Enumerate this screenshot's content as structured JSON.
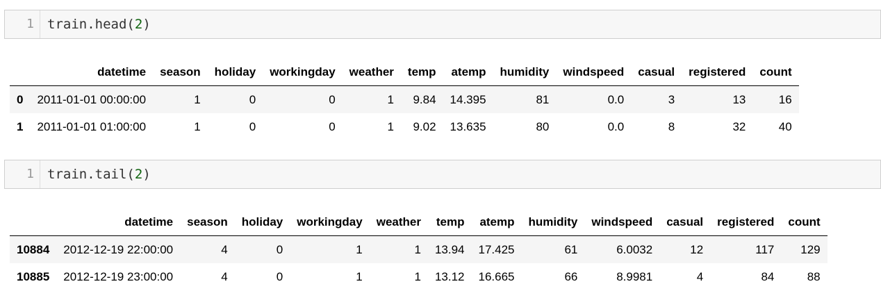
{
  "cells": [
    {
      "line_number": "1",
      "code": {
        "object": "train",
        "dot": ".",
        "method": "head",
        "open": "(",
        "arg": "2",
        "close": ")"
      },
      "table": {
        "columns": [
          "datetime",
          "season",
          "holiday",
          "workingday",
          "weather",
          "temp",
          "atemp",
          "humidity",
          "windspeed",
          "casual",
          "registered",
          "count"
        ],
        "rows": [
          {
            "index": "0",
            "values": [
              "2011-01-01 00:00:00",
              "1",
              "0",
              "0",
              "1",
              "9.84",
              "14.395",
              "81",
              "0.0",
              "3",
              "13",
              "16"
            ]
          },
          {
            "index": "1",
            "values": [
              "2011-01-01 01:00:00",
              "1",
              "0",
              "0",
              "1",
              "9.02",
              "13.635",
              "80",
              "0.0",
              "8",
              "32",
              "40"
            ]
          }
        ]
      }
    },
    {
      "line_number": "1",
      "code": {
        "object": "train",
        "dot": ".",
        "method": "tail",
        "open": "(",
        "arg": "2",
        "close": ")"
      },
      "table": {
        "columns": [
          "datetime",
          "season",
          "holiday",
          "workingday",
          "weather",
          "temp",
          "atemp",
          "humidity",
          "windspeed",
          "casual",
          "registered",
          "count"
        ],
        "rows": [
          {
            "index": "10884",
            "values": [
              "2012-12-19 22:00:00",
              "4",
              "0",
              "1",
              "1",
              "13.94",
              "17.425",
              "61",
              "6.0032",
              "12",
              "117",
              "129"
            ]
          },
          {
            "index": "10885",
            "values": [
              "2012-12-19 23:00:00",
              "4",
              "0",
              "1",
              "1",
              "13.12",
              "16.665",
              "66",
              "8.9981",
              "4",
              "84",
              "88"
            ]
          }
        ]
      }
    }
  ]
}
